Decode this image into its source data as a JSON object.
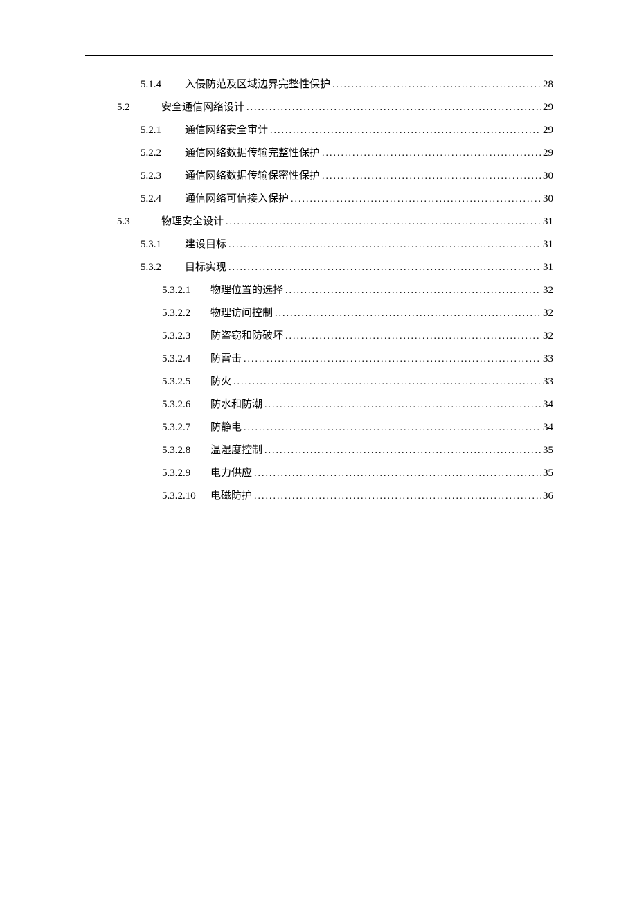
{
  "toc": [
    {
      "level": 3,
      "number": "5.1.4",
      "title": "入侵防范及区域边界完整性保护",
      "page": "28"
    },
    {
      "level": 2,
      "number": "5.2",
      "title": "安全通信网络设计",
      "page": "29"
    },
    {
      "level": 3,
      "number": "5.2.1",
      "title": "通信网络安全审计",
      "page": "29"
    },
    {
      "level": 3,
      "number": "5.2.2",
      "title": "通信网络数据传输完整性保护",
      "page": "29"
    },
    {
      "level": 3,
      "number": "5.2.3",
      "title": "通信网络数据传输保密性保护",
      "page": "30"
    },
    {
      "level": 3,
      "number": "5.2.4",
      "title": "通信网络可信接入保护",
      "page": "30"
    },
    {
      "level": 2,
      "number": "5.3",
      "title": "物理安全设计",
      "page": "31"
    },
    {
      "level": 3,
      "number": "5.3.1",
      "title": "建设目标",
      "page": "31"
    },
    {
      "level": 3,
      "number": "5.3.2",
      "title": "目标实现",
      "page": "31"
    },
    {
      "level": 4,
      "number": "5.3.2.1",
      "title": "物理位置的选择",
      "page": "32"
    },
    {
      "level": 4,
      "number": "5.3.2.2",
      "title": "物理访问控制",
      "page": "32"
    },
    {
      "level": 4,
      "number": "5.3.2.3",
      "title": "防盗窃和防破坏",
      "page": "32"
    },
    {
      "level": 4,
      "number": "5.3.2.4",
      "title": "防雷击",
      "page": "33"
    },
    {
      "level": 4,
      "number": "5.3.2.5",
      "title": "防火",
      "page": "33"
    },
    {
      "level": 4,
      "number": "5.3.2.6",
      "title": "防水和防潮",
      "page": "34"
    },
    {
      "level": 4,
      "number": "5.3.2.7",
      "title": "防静电",
      "page": "34"
    },
    {
      "level": 4,
      "number": "5.3.2.8",
      "title": "温湿度控制",
      "page": "35"
    },
    {
      "level": 4,
      "number": "5.3.2.9",
      "title": "电力供应",
      "page": "35"
    },
    {
      "level": 4,
      "number": "5.3.2.10",
      "title": "电磁防护",
      "page": "36"
    }
  ]
}
